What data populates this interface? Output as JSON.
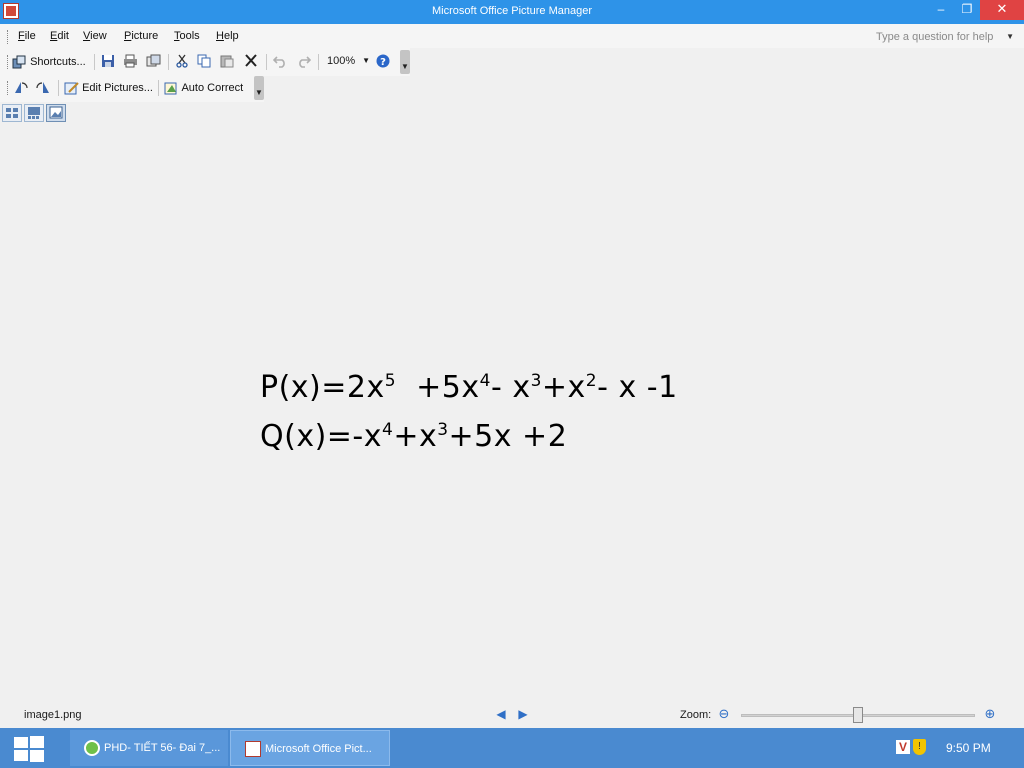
{
  "window": {
    "title": "Microsoft Office Picture Manager",
    "min_glyph": "–",
    "max_glyph": "❐",
    "close_glyph": "✕"
  },
  "menu": {
    "items": [
      {
        "label_u": "F",
        "label_rest": "ile"
      },
      {
        "label_u": "E",
        "label_rest": "dit"
      },
      {
        "label_u": "V",
        "label_rest": "iew"
      },
      {
        "label_u": "P",
        "label_rest": "icture"
      },
      {
        "label_u": "T",
        "label_rest": "ools"
      },
      {
        "label_u": "H",
        "label_rest": "elp"
      }
    ],
    "help_placeholder": "Type a question for help"
  },
  "toolbar1": {
    "shortcuts_label": "Shortcuts...",
    "zoom_value": "100%"
  },
  "toolbar2": {
    "edit_pictures_label": "Edit Pictures...",
    "auto_correct_label": "Auto Correct"
  },
  "image": {
    "line1": {
      "prefix": "P(x)=2x",
      "e1": "5",
      "t2": "  +5x",
      "e2": "4",
      "t3": "- x",
      "e3": "3",
      "t4": "+x",
      "e4": "2",
      "t5": "- x -1"
    },
    "line2": {
      "prefix": "Q(x)=-x",
      "e1": "4",
      "t2": "+x",
      "e2": "3",
      "t3": "+5x +2"
    }
  },
  "status": {
    "filename": "image1.png",
    "zoom_label": "Zoom:",
    "zoom_slider_fraction": 0.5
  },
  "taskbar": {
    "task1_label": "PHD- TIẾT 56- Đai 7_...",
    "task2_label": "Microsoft Office Pict...",
    "clock": "9:50 PM"
  },
  "colors": {
    "titlebar": "#2e93e8",
    "taskbar": "#4a8ad0",
    "close": "#e04343"
  }
}
